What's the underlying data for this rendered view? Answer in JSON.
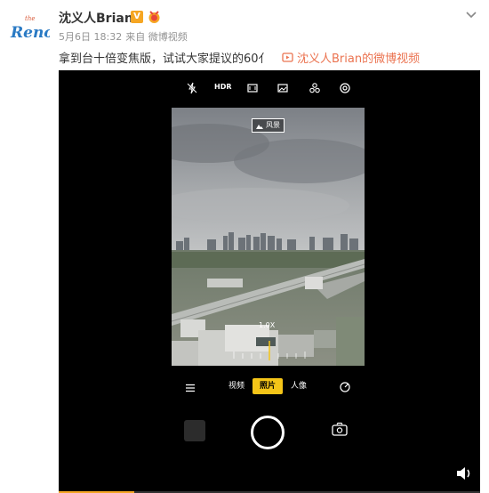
{
  "brand": {
    "logo_text": "Reno",
    "logo_small": "the"
  },
  "post": {
    "username": "沈义人Brian",
    "verified_label": "V",
    "date": "5月6日 18:32",
    "source": "来自 微博视频",
    "text": "拿到台十倍变焦版，试试大家提议的60亻",
    "video_link_label": "沈义人Brian的微博视频"
  },
  "camera": {
    "hdr_label": "HDR",
    "scene_label": "风景",
    "zoom_label": "1.0X",
    "modes": [
      "视频",
      "照片",
      "人像"
    ],
    "active_mode": "照片"
  },
  "video_progress": 0.18,
  "icons": [
    "dropdown-chevron-icon",
    "flash-off-icon",
    "hdr-icon",
    "aspect-ratio-icon",
    "filter-icon",
    "effects-icon",
    "settings-icon",
    "menu-icon",
    "camera-mode-icon",
    "flip-camera-icon",
    "volume-icon",
    "video-link-icon",
    "landscape-icon",
    "medal-icon"
  ],
  "colors": {
    "accent_orange": "#eb7350",
    "verified_yellow": "#f6a623",
    "mode_highlight": "#f5c518"
  }
}
